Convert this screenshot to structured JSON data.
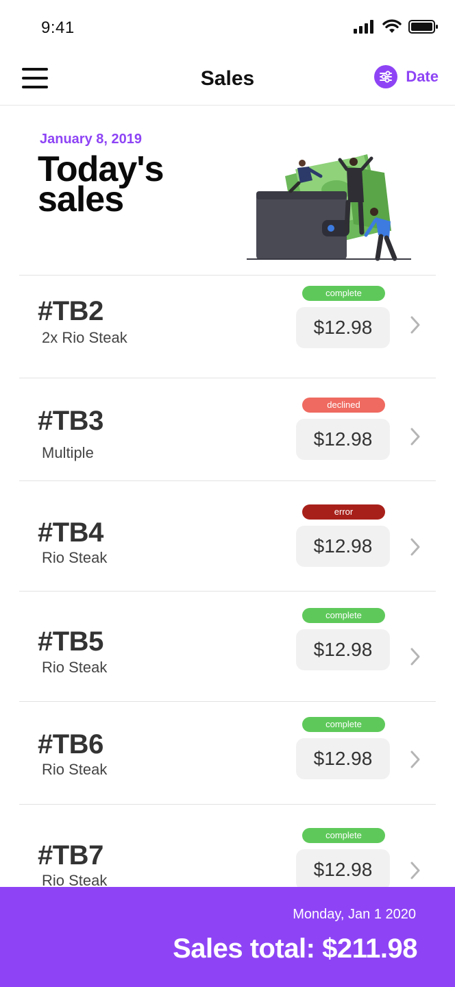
{
  "status_bar": {
    "time": "9:41"
  },
  "navbar": {
    "title": "Sales",
    "filter_label": "Date"
  },
  "hero": {
    "date": "January 8, 2019",
    "title": "Today's sales"
  },
  "sales": [
    {
      "id": "#TB2",
      "description": "2x Rio Steak",
      "status": "complete",
      "price": "$12.98"
    },
    {
      "id": "#TB3",
      "description": "Multiple",
      "status": "declined",
      "price": "$12.98"
    },
    {
      "id": "#TB4",
      "description": "Rio Steak",
      "status": "error",
      "price": "$12.98"
    },
    {
      "id": "#TB5",
      "description": "Rio Steak",
      "status": "complete",
      "price": "$12.98"
    },
    {
      "id": "#TB6",
      "description": "Rio Steak",
      "status": "complete",
      "price": "$12.98"
    },
    {
      "id": "#TB7",
      "description": "Rio Steak",
      "status": "complete",
      "price": "$12.98"
    }
  ],
  "status_colors": {
    "complete": "#5ec95a",
    "declined": "#ef6a60",
    "error": "#a8201a"
  },
  "footer": {
    "date": "Monday, Jan 1 2020",
    "total_text": "Sales total: $211.98"
  },
  "colors": {
    "accent": "#8e44f5"
  },
  "icons": {
    "menu": "hamburger-icon",
    "filter": "sliders-icon",
    "chevron": "chevron-right-icon"
  }
}
